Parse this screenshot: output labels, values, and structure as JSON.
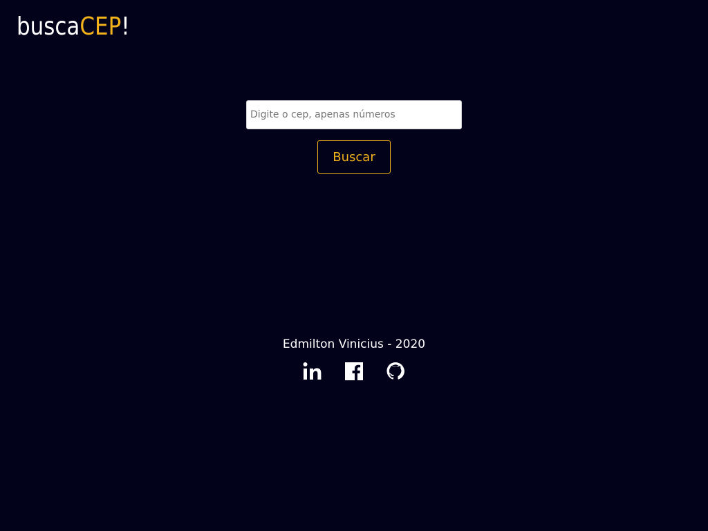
{
  "logo": {
    "prefix": "busca",
    "accent": "CEP",
    "suffix": "!"
  },
  "search": {
    "placeholder": "Digite o cep, apenas números",
    "value": "",
    "button_label": "Buscar"
  },
  "footer": {
    "credit": "Edmilton Vinicius - 2020",
    "social": [
      {
        "icon": "linkedin-icon"
      },
      {
        "icon": "facebook-icon"
      },
      {
        "icon": "github-icon"
      }
    ]
  },
  "colors": {
    "background": "#02021a",
    "accent": "#f2b21b",
    "text": "#ffffff"
  }
}
